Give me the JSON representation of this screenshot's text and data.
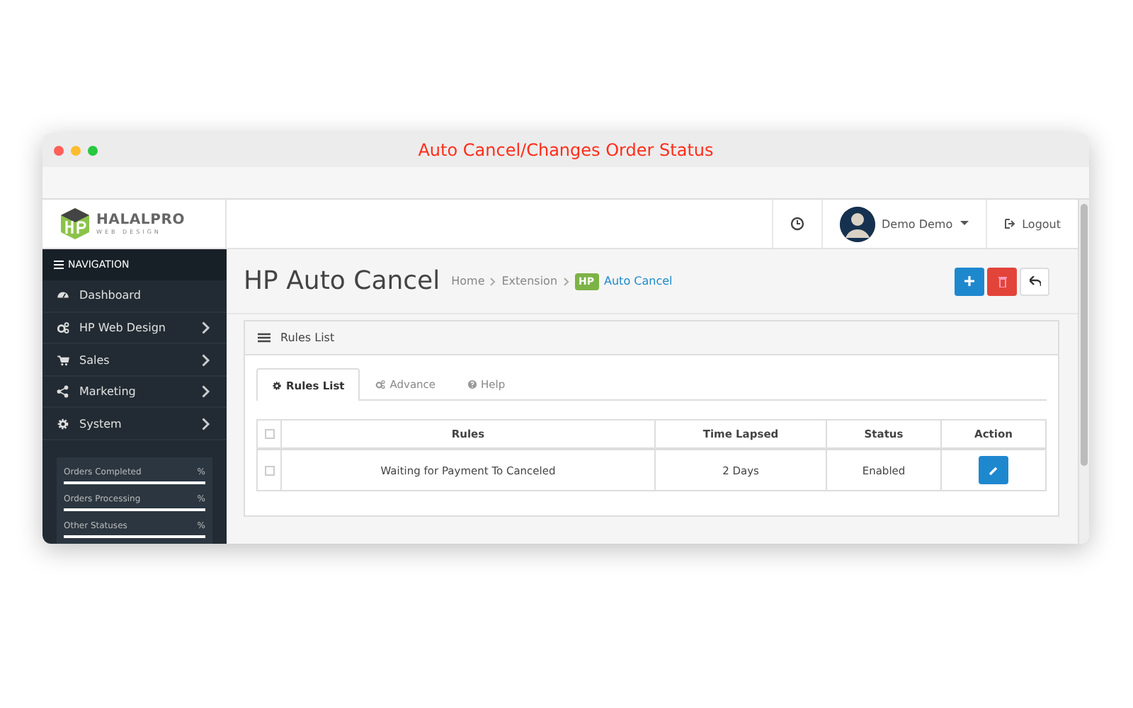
{
  "window": {
    "title": "Auto Cancel/Changes Order Status"
  },
  "header": {
    "logo": {
      "name": "HALALPRO",
      "tagline": "WEB DESIGN"
    },
    "user": "Demo Demo",
    "logout": "Logout"
  },
  "sidebar": {
    "title": "NAVIGATION",
    "items": [
      {
        "label": "Dashboard",
        "has_children": false
      },
      {
        "label": "HP Web Design",
        "has_children": true
      },
      {
        "label": "Sales",
        "has_children": true
      },
      {
        "label": "Marketing",
        "has_children": true
      },
      {
        "label": "System",
        "has_children": true
      }
    ],
    "stats": [
      {
        "label": "Orders Completed",
        "unit": "%",
        "level": 1
      },
      {
        "label": "Orders Processing",
        "unit": "%",
        "level": 1
      },
      {
        "label": "Other Statuses",
        "unit": "%",
        "level": 1
      }
    ]
  },
  "page": {
    "title": "HP Auto Cancel",
    "breadcrumbs": [
      {
        "label": "Home"
      },
      {
        "label": "Extension"
      },
      {
        "label": "Auto Cancel",
        "badge": "HP"
      }
    ]
  },
  "panel": {
    "title": "Rules List",
    "tabs": [
      {
        "label": "Rules List",
        "selected": true
      },
      {
        "label": "Advance",
        "selected": false
      },
      {
        "label": "Help",
        "selected": false
      }
    ],
    "table": {
      "columns": [
        "Rules",
        "Time Lapsed",
        "Status",
        "Action"
      ],
      "header_checked": false,
      "rows": [
        {
          "checked": false,
          "rule": "Waiting for Payment To Canceled",
          "time_lapsed": "2 Days",
          "status": "Enabled"
        }
      ]
    }
  }
}
